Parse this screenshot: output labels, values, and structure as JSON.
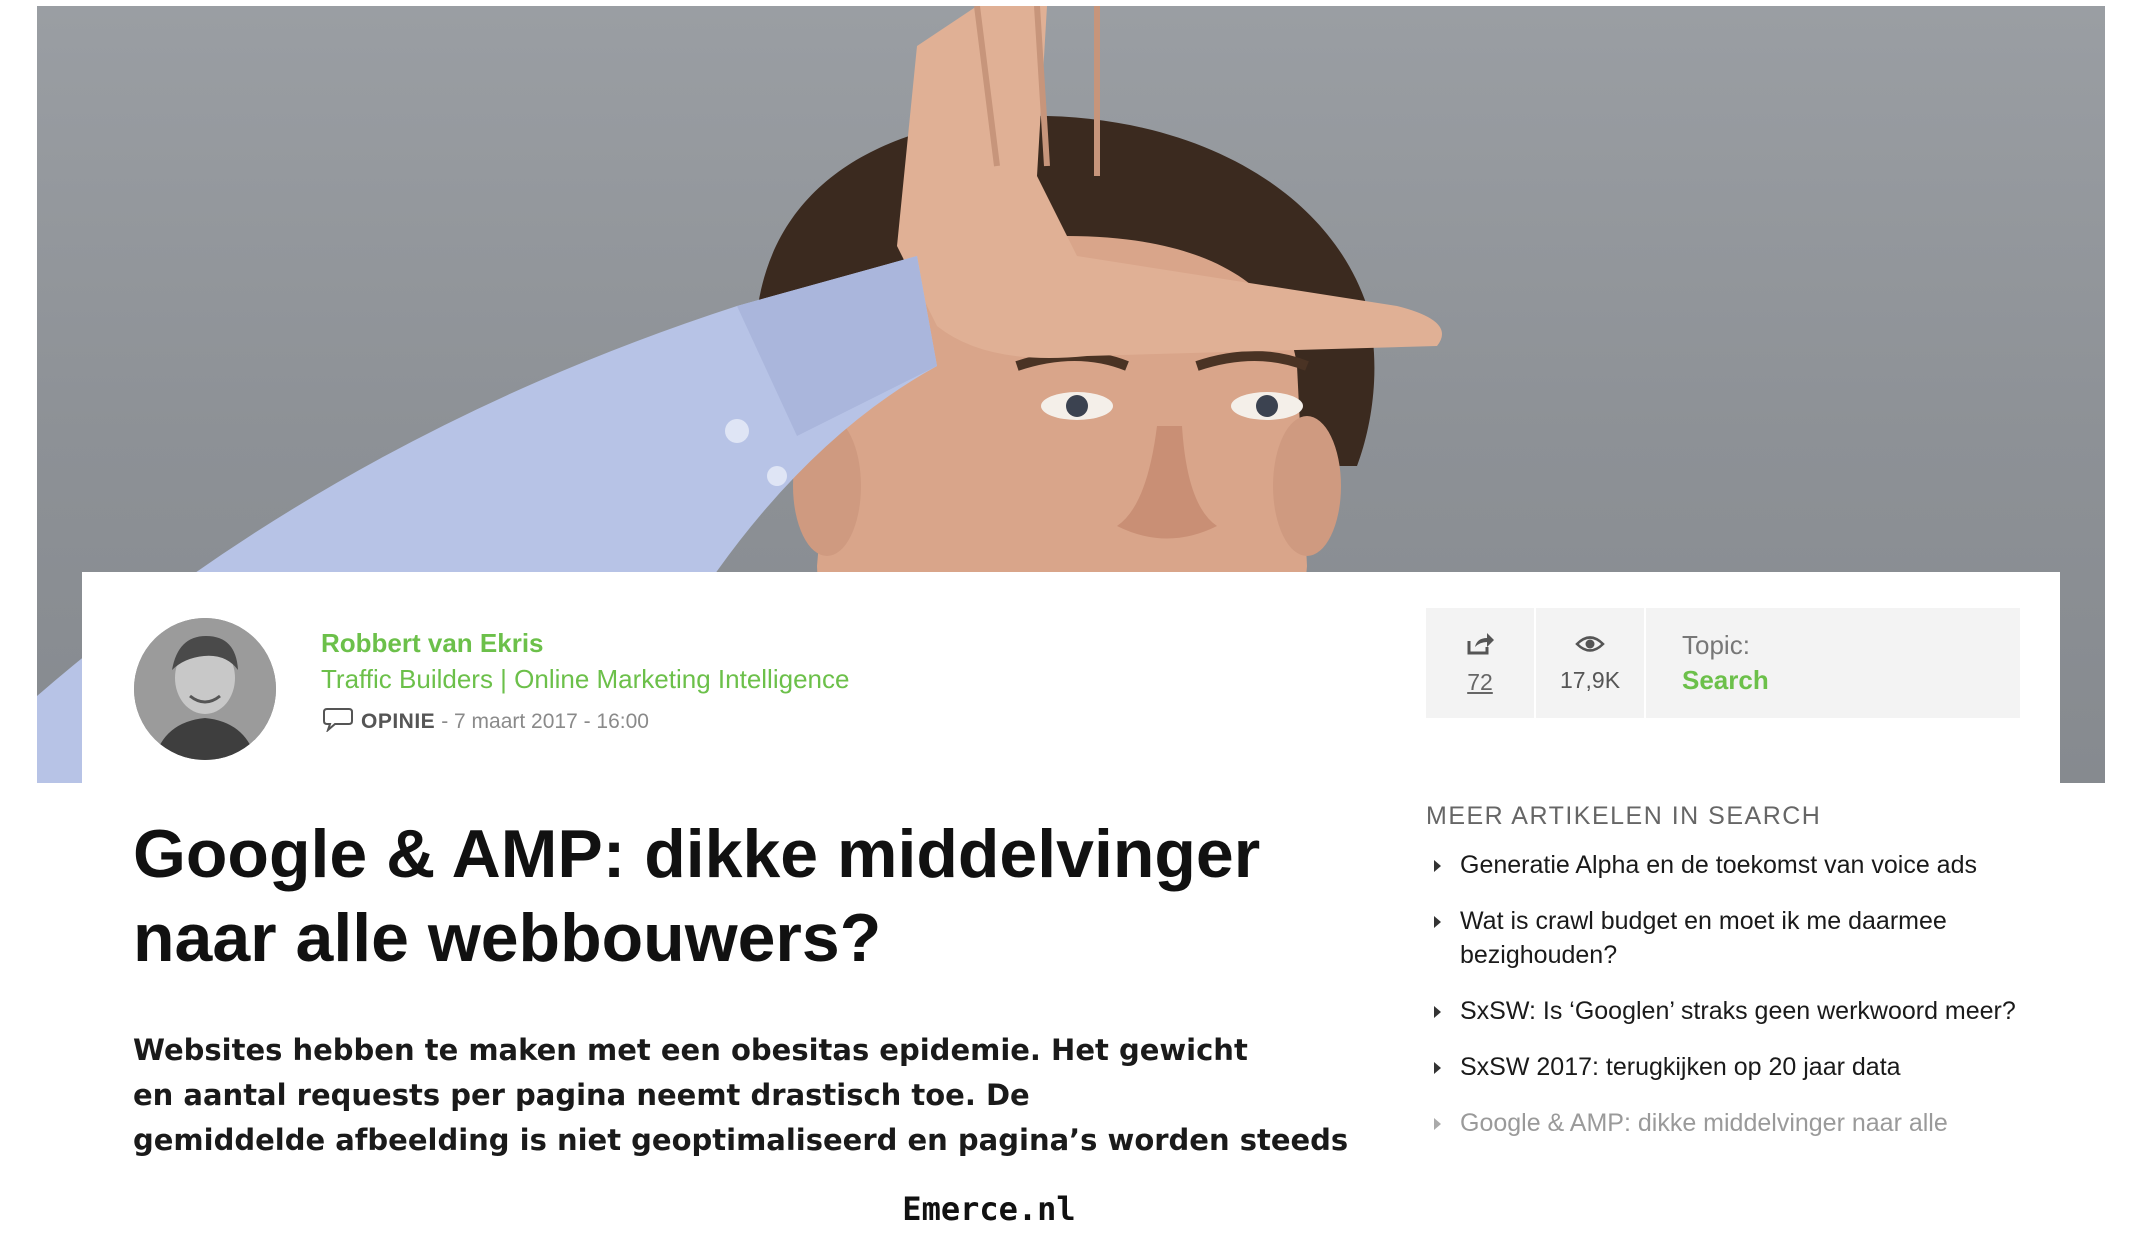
{
  "author": {
    "name": "Robbert van Ekris",
    "company": "Traffic Builders | Online Marketing Intelligence",
    "category": "OPINIE",
    "date": " - 7 maart 2017 - 16:00",
    "avatar_icon": "author-avatar-photo"
  },
  "stats": {
    "shares": "72",
    "share_icon": "share-icon",
    "views": "17,9K",
    "views_icon": "eye-icon",
    "topic_label": "Topic:",
    "topic_value": "Search"
  },
  "article": {
    "title": "Google & AMP: dikke middelvinger naar alle webbouwers?",
    "lead_lines": [
      "Websites hebben te maken met een obesitas epidemie. Het gewicht",
      "en aantal requests per pagina neemt drastisch toe. De",
      "gemiddelde afbeelding is niet geoptimaliseerd en pagina’s worden steeds"
    ]
  },
  "sidebar": {
    "heading": "MEER ARTIKELEN IN SEARCH",
    "items": [
      {
        "label": "Generatie Alpha en de toekomst van voice ads"
      },
      {
        "label": "Wat is crawl budget en moet ik me daarmee bezighouden?"
      },
      {
        "label": "SxSW: Is ‘Googlen’ straks geen werkwoord meer?"
      },
      {
        "label": "SxSW 2017: terugkijken op 20 jaar data"
      },
      {
        "label": "Google & AMP: dikke middelvinger naar alle"
      }
    ]
  },
  "footer": {
    "brand": "Emerce.nl"
  },
  "colors": {
    "accent": "#6cc04a",
    "stats_bg": "#f3f3f3"
  }
}
